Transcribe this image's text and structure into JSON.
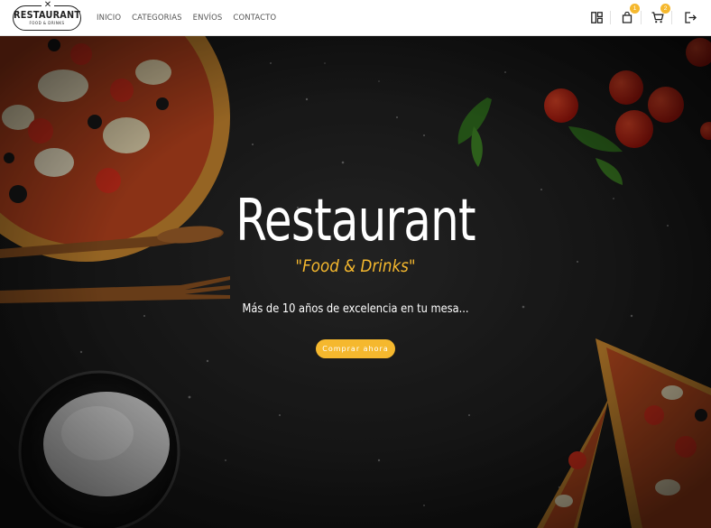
{
  "brand": {
    "title": "RESTAURANT",
    "subtitle": "FOOD & DRINKS"
  },
  "nav": {
    "links": [
      "INICIO",
      "CATEGORIAS",
      "ENVÍOS",
      "CONTACTO"
    ]
  },
  "icons": {
    "dashboard": "dashboard-icon",
    "orders": "shopping-bag-icon",
    "orders_count": "1",
    "cart": "cart-icon",
    "cart_count": "2",
    "logout": "logout-icon"
  },
  "hero": {
    "title": "Restaurant",
    "subtitle": "\"Food & Drinks\"",
    "tagline": "Más de 10 años de excelencia en tu mesa...",
    "cta_label": "Comprar ahora"
  },
  "colors": {
    "accent": "#f5b82e",
    "background": "#1c1c1c",
    "navbar": "#ffffff"
  }
}
